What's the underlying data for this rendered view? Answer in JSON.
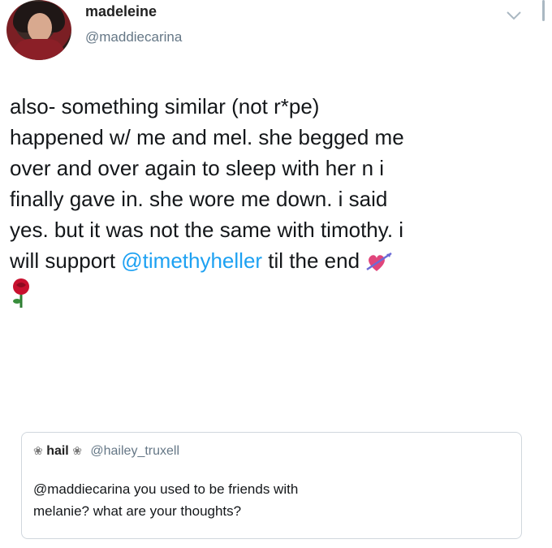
{
  "user": {
    "name": "madeleine",
    "handle": "@maddiecarina"
  },
  "tweet": {
    "lines": [
      "also- something similar (not r*pe)",
      "happened w/ me and mel. she begged me",
      "over and over again to sleep with her n i",
      "finally gave in. she wore me down. i said",
      "yes. but it was not the same with timothy. i"
    ],
    "last_line_prefix": "will support ",
    "mention": "@timethyheller",
    "last_line_suffix": " til the end",
    "emoji_1": "heart-with-arrow-icon",
    "emoji_2": "rose-icon"
  },
  "quoted": {
    "flower_left": "❀",
    "name": "hail",
    "flower_right": "❀",
    "handle": "@hailey_truxell",
    "lines": [
      "@maddiecarina you used to be friends with",
      "melanie? what are your thoughts?"
    ]
  },
  "colors": {
    "mention": "#1da1f2",
    "handle": "#657786",
    "border": "#d0d7dd"
  }
}
